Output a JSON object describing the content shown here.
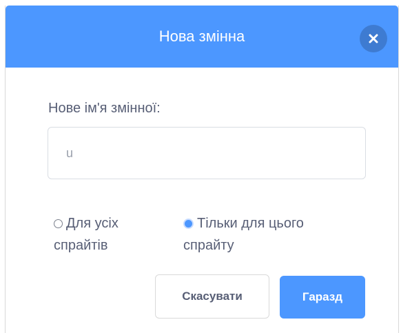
{
  "dialog": {
    "title": "Нова змінна",
    "close_icon": "close-icon",
    "prompt": "Нове ім'я змінної:",
    "input": {
      "value": "u",
      "placeholder": ""
    },
    "options": {
      "all_sprites": {
        "line1": "Для усіх",
        "line2": "спрайтів",
        "checked": false
      },
      "this_sprite": {
        "line1": "Тільки для цього",
        "line2": "спрайту",
        "checked": true
      }
    },
    "buttons": {
      "cancel": "Скасувати",
      "ok": "Гаразд"
    },
    "colors": {
      "accent": "#4c97ff",
      "text": "#575e75"
    }
  }
}
